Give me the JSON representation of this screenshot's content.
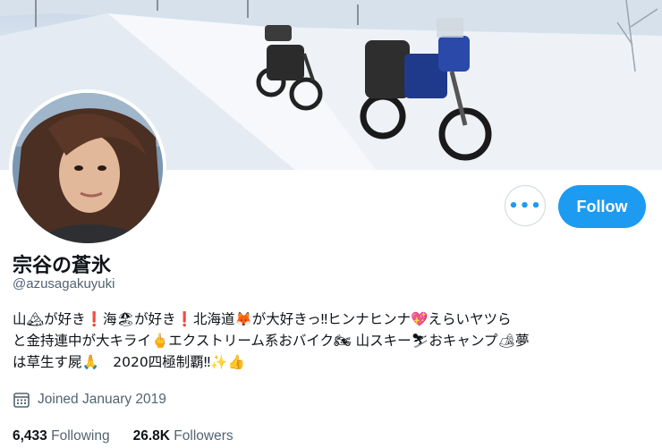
{
  "profile": {
    "display_name": "宗谷の蒼氷",
    "handle": "@azusagakuyuki",
    "bio_lines": [
      "山🏔が好き❗海🏖が好き❗北海道🦊が大好きっ‼ヒンナヒンナ💖えらいヤツら",
      "と金持連中が大キライ🖕エクストリーム系おバイク🏍 山スキー⛷おキャンプ🏕夢",
      "は草生す屍🙏　2020四極制覇‼✨👍"
    ],
    "joined": "Joined January 2019"
  },
  "actions": {
    "more_label": "•••",
    "follow_label": "Follow"
  },
  "stats": {
    "following_count": "6,433",
    "following_label": "Following",
    "followers_count": "26.8K",
    "followers_label": "Followers"
  },
  "colors": {
    "accent": "#1d9bf0",
    "secondary_text": "#536471",
    "primary_text": "#0f1419",
    "border": "#cfd9de"
  },
  "icons": {
    "more": "more-horizontal-icon",
    "joined": "calendar-icon"
  }
}
